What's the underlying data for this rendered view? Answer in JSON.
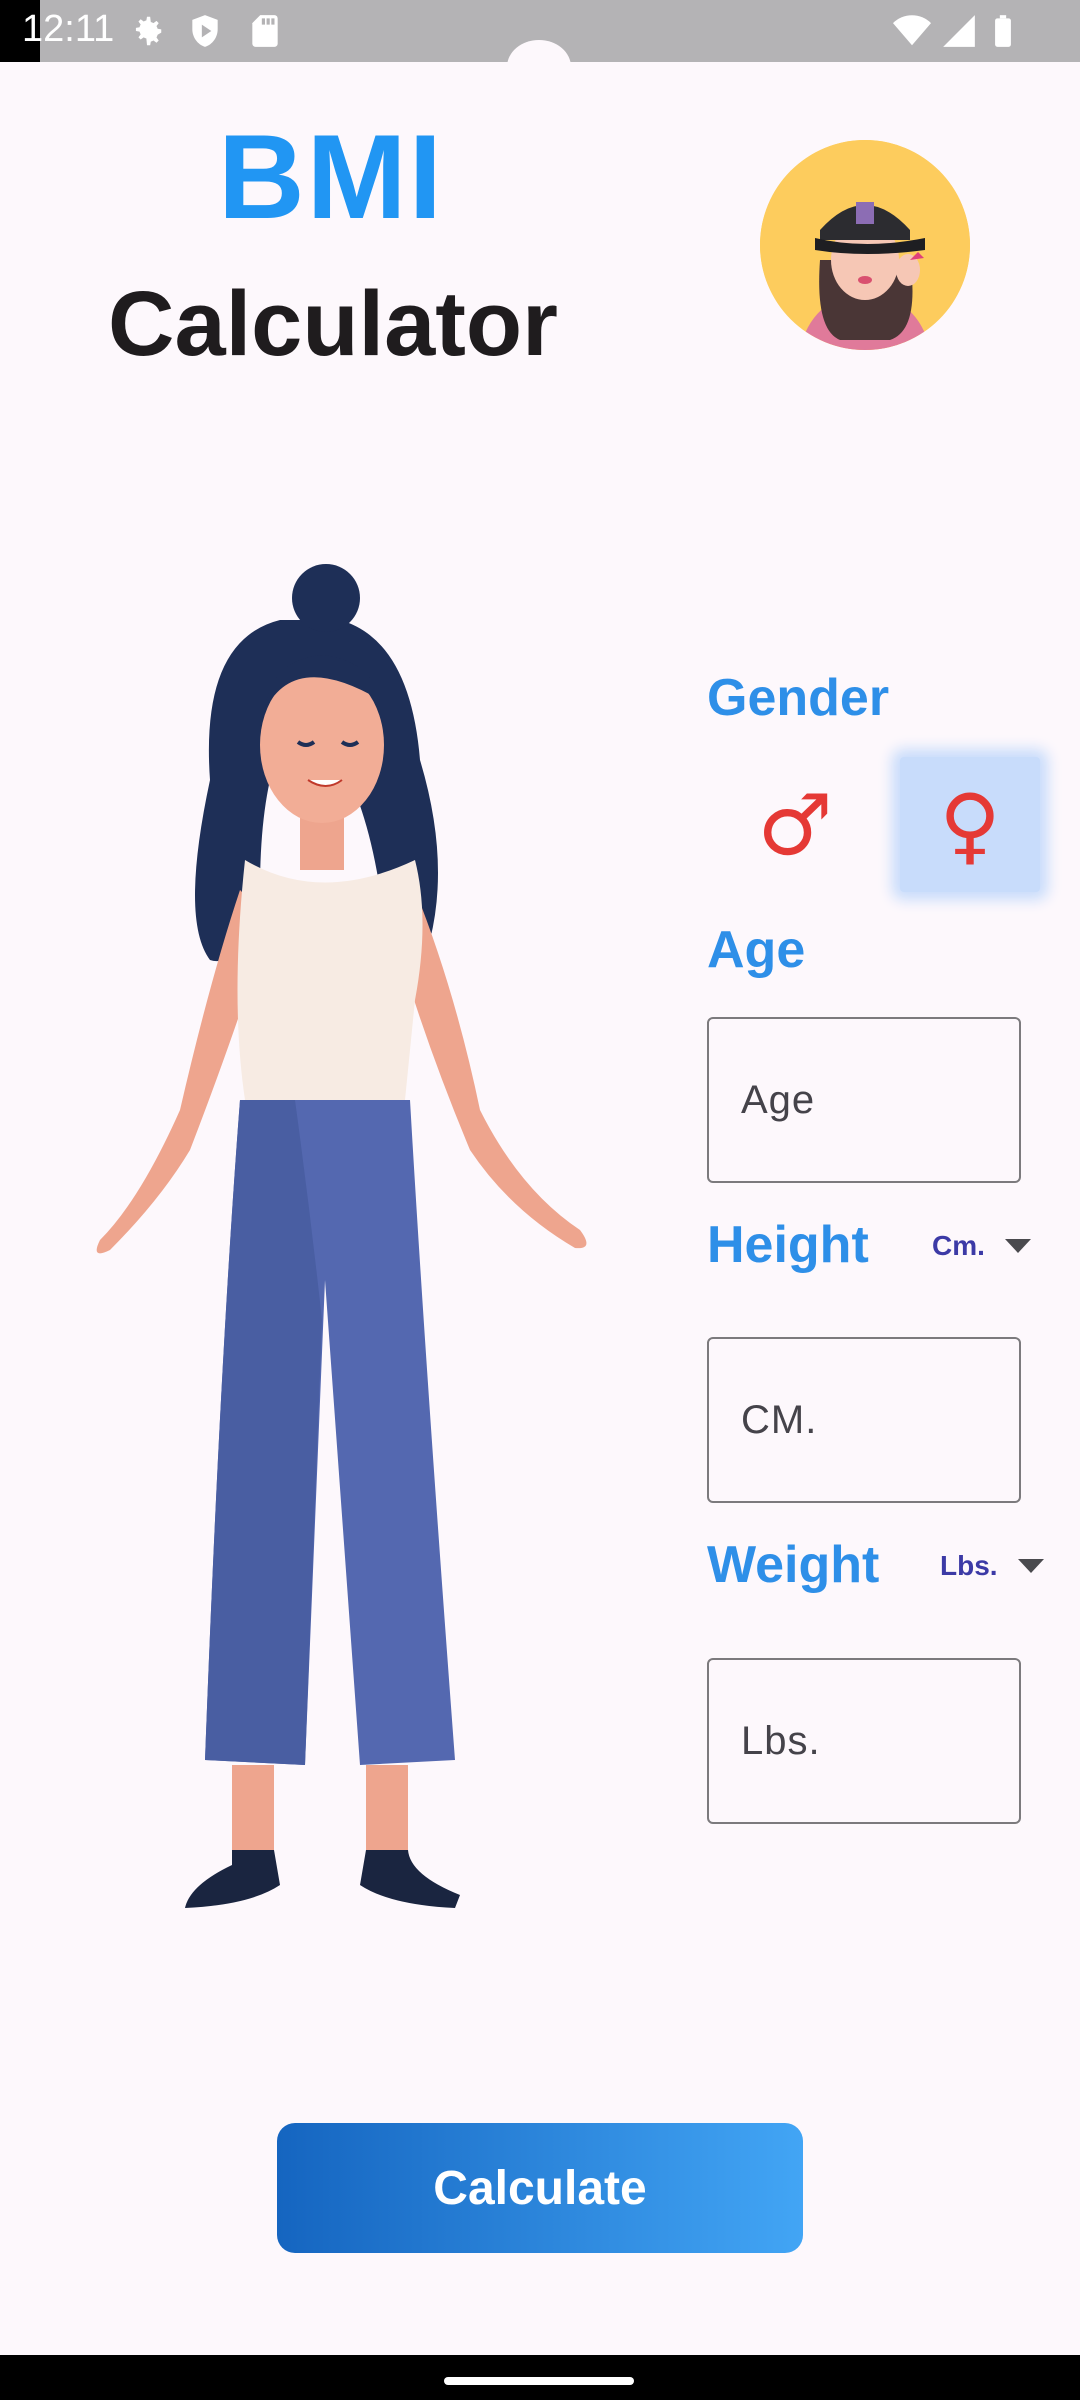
{
  "status_bar": {
    "time": "12:11",
    "left_icons": [
      "settings-icon",
      "shield-icon",
      "sd-card-icon"
    ],
    "right_icons": [
      "wifi-icon",
      "signal-icon",
      "battery-icon"
    ]
  },
  "header": {
    "title_line1": "BMI",
    "title_line2": "Calculator"
  },
  "form": {
    "gender_label": "Gender",
    "male_symbol": "♂",
    "female_symbol": "♀",
    "selected_gender": "female",
    "age_label": "Age",
    "age_placeholder": "Age",
    "height_label": "Height",
    "height_unit": "Cm.",
    "height_placeholder": "CM.",
    "weight_label": "Weight",
    "weight_unit": "Lbs.",
    "weight_placeholder": "Lbs."
  },
  "actions": {
    "calculate_label": "Calculate"
  },
  "colors": {
    "accent": "#2196f3",
    "gender_symbol": "#e53935",
    "selected_bg": "#c8dcfb",
    "button_start": "#1565c0",
    "button_end": "#42a5f5"
  }
}
